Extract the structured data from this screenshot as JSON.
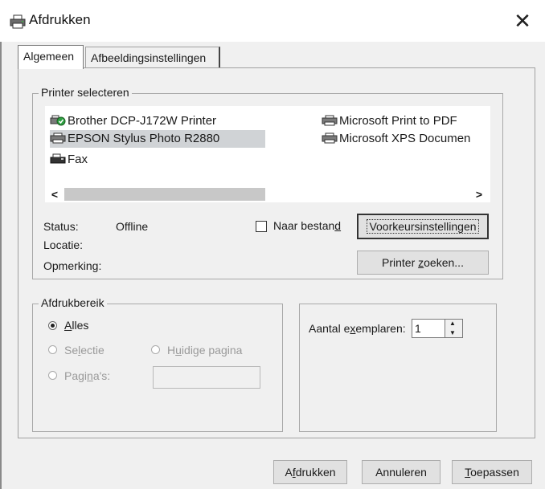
{
  "window": {
    "title": "Afdrukken",
    "close_glyph": "✕",
    "icon": "printer-icon"
  },
  "tabs": [
    {
      "label": "Algemeen",
      "active": true
    },
    {
      "label": "Afbeeldingsinstellingen",
      "active": false
    }
  ],
  "printer_select": {
    "group_label": "Printer selecteren",
    "printers": [
      {
        "name": "Brother DCP-J172W Printer",
        "icon": "default-printer-icon",
        "selected": false
      },
      {
        "name": "EPSON Stylus Photo R2880",
        "icon": "printer-icon",
        "selected": true
      },
      {
        "name": "Fax",
        "icon": "fax-icon",
        "selected": false
      },
      {
        "name": "Microsoft Print to PDF",
        "icon": "printer-icon",
        "selected": false
      },
      {
        "name": "Microsoft XPS Documen",
        "icon": "printer-icon",
        "selected": false
      }
    ],
    "scroll_left": "<",
    "scroll_right": ">",
    "status_label": "Status:",
    "status_value": "Offline",
    "location_label": "Locatie:",
    "comment_label": "Opmerking:",
    "to_file_label_pre": "Naar bestan",
    "to_file_label_ul": "d",
    "to_file_checked": false,
    "prefs_button": "Voorkeursinstellingen",
    "find_button_pre": "Printer ",
    "find_button_ul": "z",
    "find_button_post": "oeken..."
  },
  "print_range": {
    "group_label": "Afdrukbereik",
    "all_ul": "A",
    "all_post": "lles",
    "selection_pre": "Se",
    "selection_ul": "l",
    "selection_post": "ectie",
    "current_pre": "H",
    "current_ul": "u",
    "current_post": "idige pagina",
    "pages_pre": "Pagi",
    "pages_ul": "n",
    "pages_post": "a's:",
    "selected": "Alles"
  },
  "copies": {
    "label_pre": "Aantal e",
    "label_ul": "x",
    "label_post": "emplaren:",
    "value": "1"
  },
  "footer": {
    "print_pre": "A",
    "print_ul": "f",
    "print_post": "drukken",
    "cancel": "Annuleren",
    "apply_ul": "T",
    "apply_post": "oepassen"
  }
}
